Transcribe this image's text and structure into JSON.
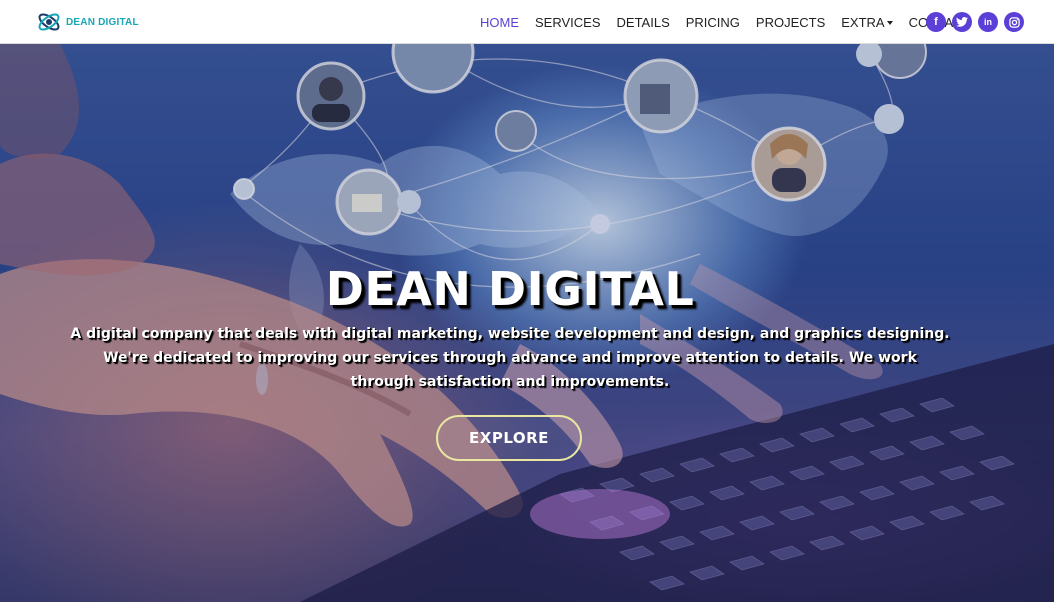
{
  "brand": {
    "name": "DEAN DIGITAL",
    "tagline": "",
    "accent": "#17a6b5"
  },
  "nav": {
    "items": [
      {
        "label": "HOME",
        "active": true
      },
      {
        "label": "SERVICES",
        "active": false
      },
      {
        "label": "DETAILS",
        "active": false
      },
      {
        "label": "PRICING",
        "active": false
      },
      {
        "label": "PROJECTS",
        "active": false
      },
      {
        "label": "EXTRA",
        "active": false,
        "dropdown": true
      },
      {
        "label": "CONTACT",
        "active": false
      }
    ],
    "active_color": "#5b3fd6"
  },
  "social": [
    {
      "name": "facebook-icon",
      "glyph": "f"
    },
    {
      "name": "twitter-icon",
      "glyph": "t"
    },
    {
      "name": "linkedin-icon",
      "glyph": "in"
    },
    {
      "name": "instagram-icon",
      "glyph": "◎"
    }
  ],
  "hero": {
    "title": "DEAN DIGITAL",
    "description": "A digital company that deals with digital marketing, website development and design, and graphics designing. We're dedicated to improving our services through advance and improve attention to details. We work through satisfaction and improvements.",
    "cta_label": "EXPLORE",
    "cta_border": "#e8e6a0"
  }
}
